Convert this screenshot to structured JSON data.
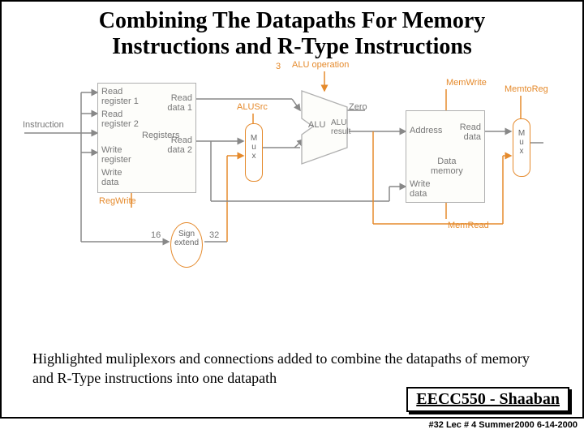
{
  "title_line1": "Combining The Datapaths For Memory",
  "title_line2": "Instructions and R-Type Instructions",
  "diagram": {
    "instruction": "Instruction",
    "reg": {
      "rr1": "Read\nregister 1",
      "rr2": "Read\nregister 2",
      "wr": "Write\nregister",
      "wd": "Write\ndata",
      "rd1": "Read\ndata 1",
      "rd2": "Read\ndata 2",
      "name": "Registers"
    },
    "signals": {
      "aluop": "ALU operation",
      "alusrc": "ALUSrc",
      "regwrite": "RegWrite",
      "memwrite": "MemWrite",
      "memread": "MemRead",
      "memtoreg": "MemtoReg",
      "three": "3"
    },
    "alu": {
      "name": "ALU",
      "zero": "Zero",
      "result": "ALU\nresult"
    },
    "mem": {
      "name": "Data\nmemory",
      "addr": "Address",
      "rd": "Read\ndata",
      "wd": "Write\ndata"
    },
    "mux": "M\nu\nx",
    "sign": "Sign\nextend",
    "w16": "16",
    "w32": "32"
  },
  "caption": "Highlighted muliplexors and connections added to combine the datapaths of memory and R-Type instructions into one datapath",
  "footer": "EECC550 - Shaaban",
  "subfooter": "#32  Lec # 4   Summer2000    6-14-2000"
}
